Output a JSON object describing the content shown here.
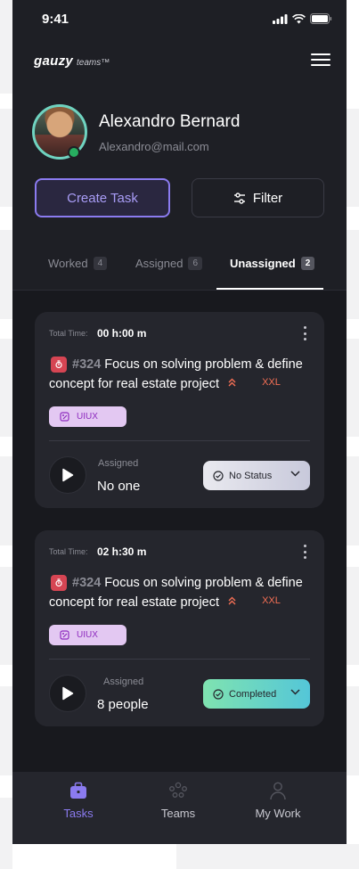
{
  "status_bar": {
    "time": "9:41"
  },
  "brand": {
    "name": "gauzy",
    "suffix": "teams™"
  },
  "profile": {
    "name": "Alexandro Bernard",
    "email": "Alexandro@mail.com"
  },
  "actions": {
    "create_task": "Create Task",
    "filter": "Filter"
  },
  "tabs": [
    {
      "label": "Worked",
      "count": "4"
    },
    {
      "label": "Assigned",
      "count": "6"
    },
    {
      "label": "Unassigned",
      "count": "2",
      "active": true
    }
  ],
  "tasks": [
    {
      "total_time_label": "Total Time:",
      "total_time": "00 h:00 m",
      "number": "#324",
      "title": "Focus on solving problem & define concept for real estate project",
      "size": "XXL",
      "label": "UIUX",
      "assigned_label": "Assigned",
      "assigned_value": "No one",
      "status": "No Status"
    },
    {
      "total_time_label": "Total Time:",
      "total_time": "02 h:30 m",
      "number": "#324",
      "title": "Focus on solving problem & define concept for real estate project",
      "size": "XXL",
      "label": "UIUX",
      "assigned_label": "Assigned",
      "assigned_value": "8 people",
      "status": "Completed"
    }
  ],
  "bottom_nav": [
    {
      "label": "Tasks",
      "icon": "briefcase-icon",
      "active": true
    },
    {
      "label": "Teams",
      "icon": "people-icon"
    },
    {
      "label": "My Work",
      "icon": "person-icon"
    }
  ],
  "colors": {
    "background": "#1e1f25",
    "accent": "#8b7bf0",
    "bug": "#d64553",
    "size": "#f36f55",
    "label_bg": "#e3c8f2",
    "completed": "#54c6d8"
  }
}
